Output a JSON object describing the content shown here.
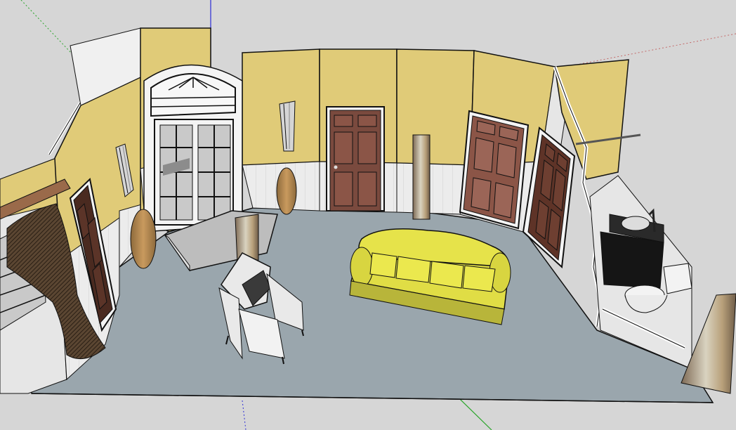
{
  "viewport": {
    "background": "#d6d6d6",
    "axis_colors": {
      "red": "#c46a6a",
      "green": "#2aa52a",
      "blue": "#2b2bd6"
    }
  },
  "colors": {
    "floor": "#9aa6ad",
    "wall_upper": "#e0cb78",
    "wall_lower": "#e6e6e6",
    "edge": "#111111",
    "door": "#7a4a3e",
    "door_panel": "#8b5547",
    "sofa": "#e6e34a",
    "sofa_shadow": "#b8b53a",
    "armchair": "#e9e9e9",
    "armchair_cushion": "#3a3a3a",
    "vase": "#b58a52",
    "column": "#9c8a73",
    "cabinet": "#151515",
    "toilet": "#f3f3f3",
    "curtain": "#3e2f22",
    "valance": "#9a6a4a",
    "glass": "#c9c9c9",
    "step": "#bdbdbd"
  },
  "scene": {
    "objects": [
      "left-wall",
      "back-wall",
      "right-wall",
      "french-doors",
      "fanlight-window",
      "back-door",
      "right-door-1",
      "right-door-2",
      "left-door",
      "sofa",
      "armchair",
      "tall-vase-left",
      "tall-vase-back",
      "wall-sconce-left",
      "wall-sconce-back",
      "light-column-center",
      "light-column-back",
      "light-column-right",
      "bathroom-vanity",
      "toilet",
      "curtained-window",
      "curtain-rod",
      "entry-step"
    ]
  }
}
